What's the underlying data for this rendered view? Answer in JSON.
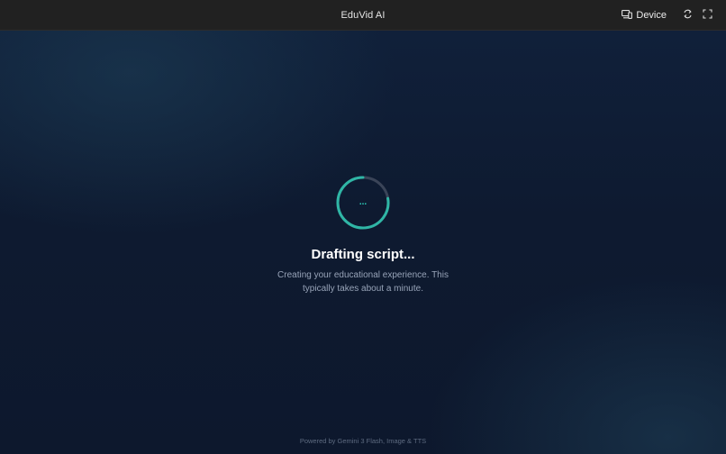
{
  "header": {
    "title": "EduVid AI",
    "device_label": "Device",
    "icons": {
      "device": "device-icon",
      "rotate": "rotate-icon",
      "fullscreen": "fullscreen-icon"
    }
  },
  "loading": {
    "spinner_label": "...",
    "title": "Drafting script...",
    "description": "Creating your educational experience. This typically takes about a minute.",
    "accent_color": "#2dd4bf"
  },
  "footer": {
    "text": "Powered by Gemini 3 Flash, Image & TTS"
  }
}
